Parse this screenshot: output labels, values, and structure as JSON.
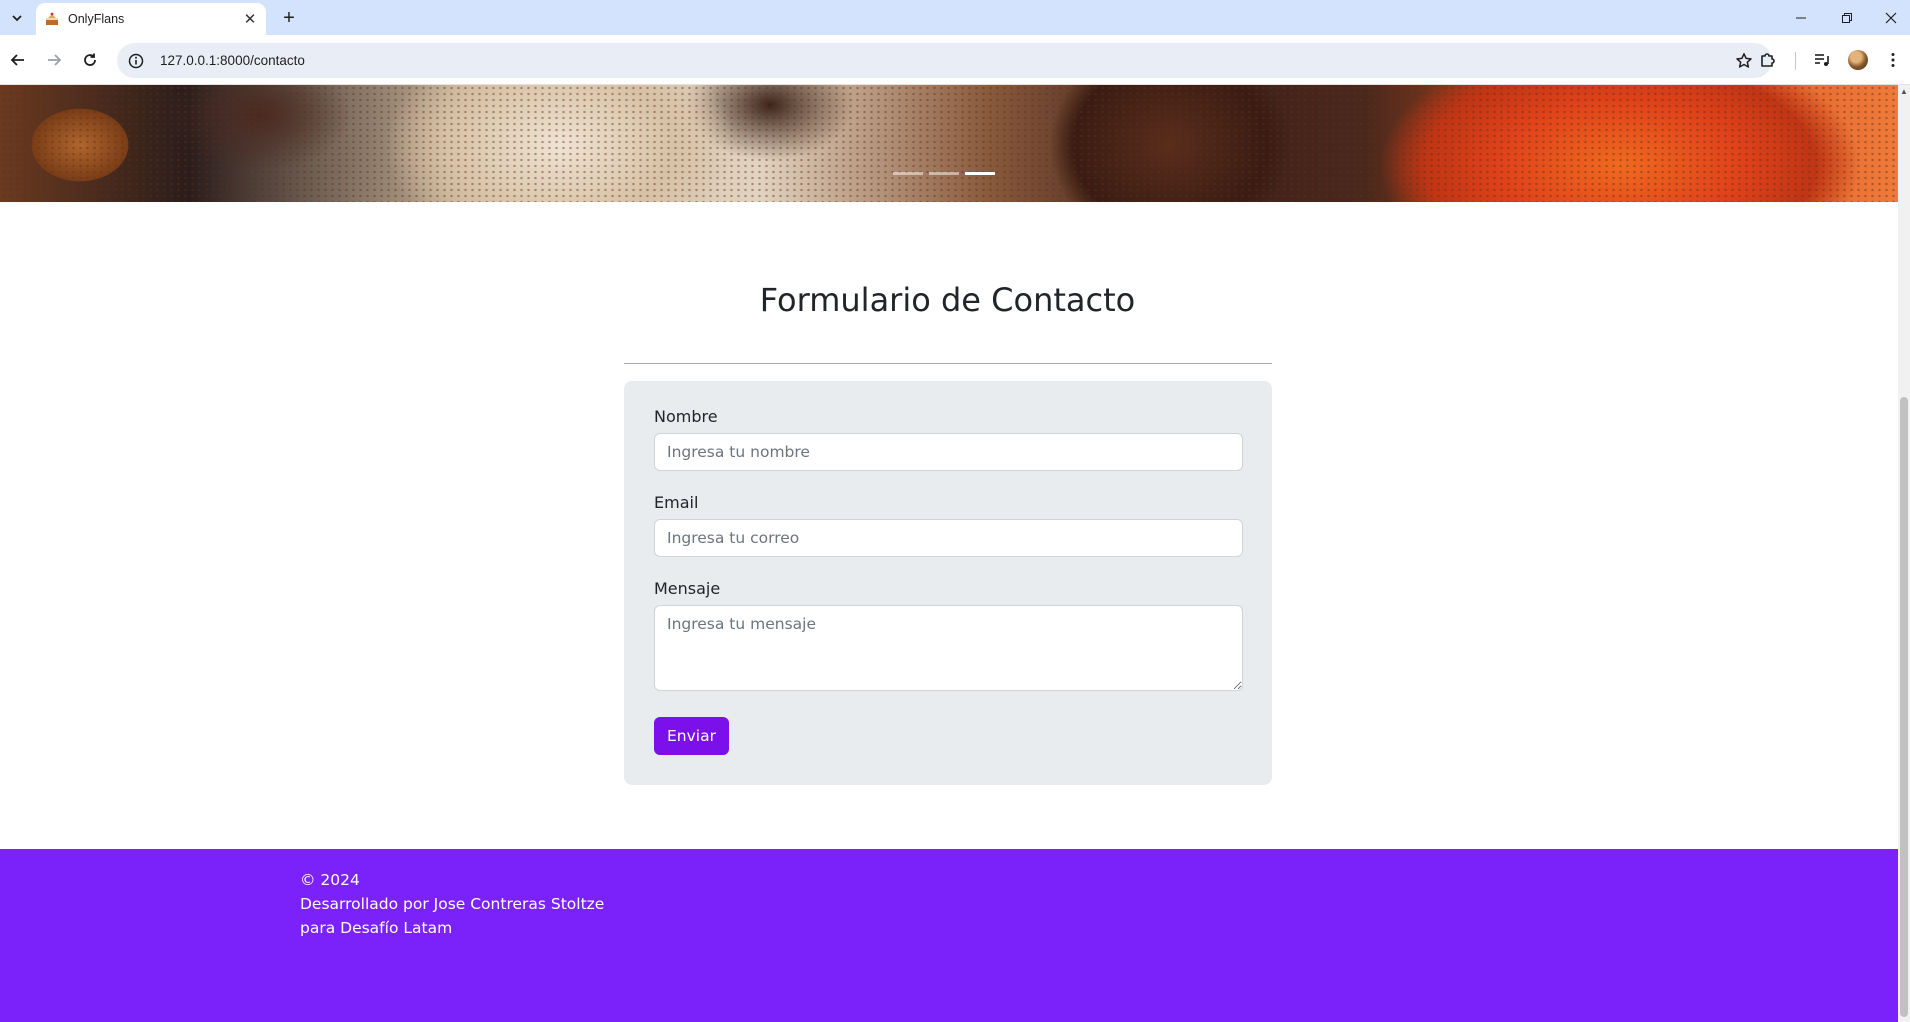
{
  "browser": {
    "tab_title": "OnlyFlans",
    "url": "127.0.0.1:8000/contacto",
    "new_tab_symbol": "+",
    "close_tab_symbol": "✕"
  },
  "carousel": {
    "indicator_count": 3,
    "active_index": 2
  },
  "page": {
    "title": "Formulario de Contacto"
  },
  "form": {
    "name_label": "Nombre",
    "name_placeholder": "Ingresa tu nombre",
    "email_label": "Email",
    "email_placeholder": "Ingresa tu correo",
    "message_label": "Mensaje",
    "message_placeholder": "Ingresa tu mensaje",
    "submit_label": "Enviar"
  },
  "footer": {
    "copyright": "© 2024",
    "credit": "Desarrollado por Jose Contreras Stoltze",
    "organization": "para Desafío Latam"
  },
  "colors": {
    "accent": "#7b10ea",
    "footer_bg": "#7b22fa",
    "card_bg": "#e9ecef",
    "browser_tab_strip": "#d3e3fd"
  },
  "icons": {
    "tab_search": "chevron-down-icon",
    "favicon": "cake-icon",
    "back": "arrow-left-icon",
    "forward": "arrow-right-icon",
    "reload": "reload-icon",
    "site_info": "info-icon",
    "bookmark": "star-icon",
    "extensions": "puzzle-icon",
    "media": "media-control-icon",
    "menu": "kebab-menu-icon"
  }
}
